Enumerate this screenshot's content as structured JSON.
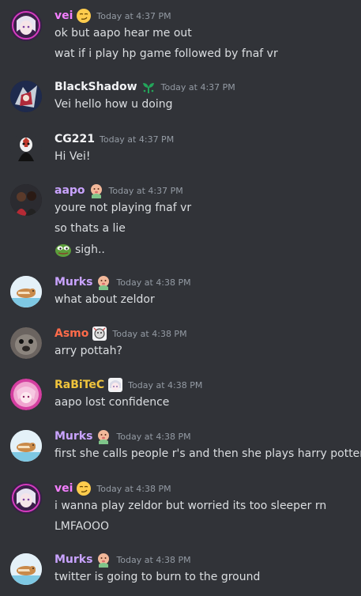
{
  "messages": [
    {
      "user": "vei",
      "color": "#f47fff",
      "badge": "smirk-emoji",
      "time": "Today at 4:37 PM",
      "lines": [
        "ok but aapo hear me out",
        "wat if i play hp game followed by fnaf vr"
      ]
    },
    {
      "user": "BlackShadow",
      "color": "#f2f3f5",
      "badge": "sprout-icon",
      "time": "Today at 4:37 PM",
      "lines": [
        "Vei hello how u doing"
      ]
    },
    {
      "user": "CG221",
      "color": "#f2f3f5",
      "time": "Today at 4:37 PM",
      "lines": [
        "Hi Vei!"
      ]
    },
    {
      "user": "aapo",
      "color": "#c9a3ff",
      "badge": "baby-emoji",
      "time": "Today at 4:37 PM",
      "lines": [
        "youre not playing fnaf vr",
        "so thats a lie",
        "sigh.."
      ]
    },
    {
      "user": "Murks",
      "color": "#c9a3ff",
      "badge": "baby-emoji",
      "time": "Today at 4:38 PM",
      "lines": [
        "what about zeldor"
      ]
    },
    {
      "user": "Asmo",
      "color": "#ff6b4a",
      "badge": "sticker-emoji",
      "time": "Today at 4:38 PM",
      "lines": [
        "arry pottah?"
      ]
    },
    {
      "user": "RaBiTeC",
      "color": "#f0c43c",
      "badge": "anime-face-emoji",
      "time": "Today at 4:38 PM",
      "lines": [
        "aapo lost confidence"
      ]
    },
    {
      "user": "Murks",
      "color": "#c9a3ff",
      "badge": "baby-emoji",
      "time": "Today at 4:38 PM",
      "lines": [
        "first she calls people r's and then she plays harry potter"
      ]
    },
    {
      "user": "vei",
      "color": "#f47fff",
      "badge": "smirk-emoji",
      "time": "Today at 4:38 PM",
      "lines": [
        "i wanna play zeldor but worried its too sleeper rn",
        "LMFAOOO"
      ]
    },
    {
      "user": "Murks",
      "color": "#c9a3ff",
      "badge": "baby-emoji",
      "time": "Today at 4:38 PM",
      "lines": [
        "twitter is going to burn to the ground"
      ]
    }
  ]
}
